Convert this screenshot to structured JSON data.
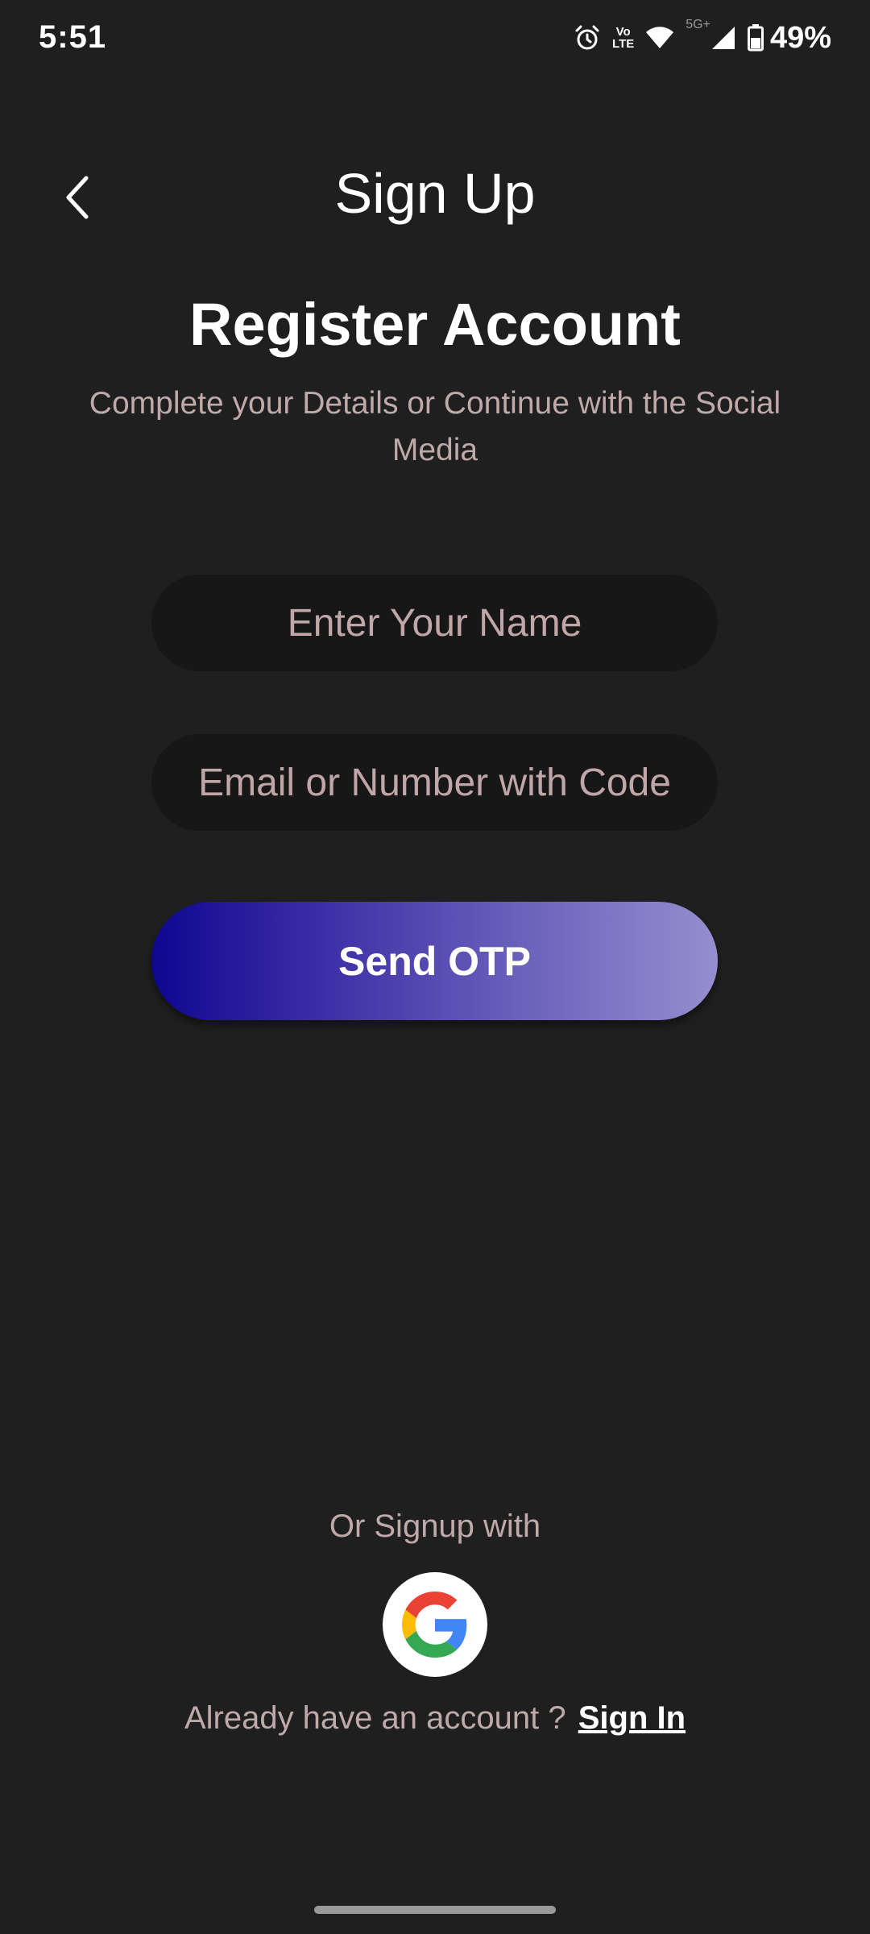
{
  "status_bar": {
    "time": "5:51",
    "volte_top": "Vo",
    "volte_bottom": "LTE",
    "network": "5G+",
    "battery": "49%",
    "icons": [
      "alarm-icon",
      "volte-icon",
      "wifi-icon",
      "signal-icon",
      "battery-icon"
    ]
  },
  "header": {
    "back_icon": "chevron-left-icon",
    "title": "Sign Up"
  },
  "intro": {
    "title": "Register Account",
    "subtitle": "Complete your Details or Continue with the Social Media"
  },
  "form": {
    "name_placeholder": "Enter Your Name",
    "name_value": "",
    "contact_placeholder": "Email or Number with Code",
    "contact_value": "",
    "submit_label": "Send OTP"
  },
  "social": {
    "label": "Or Signup with",
    "provider_icon": "google-icon"
  },
  "footer": {
    "prompt": "Already have an account ?",
    "link": "Sign In"
  },
  "colors": {
    "background": "#1f1f1f",
    "input_background": "#171717",
    "muted_text": "#bfa9a9",
    "button_gradient_start": "#0e0790",
    "button_gradient_end": "#968ecf"
  }
}
